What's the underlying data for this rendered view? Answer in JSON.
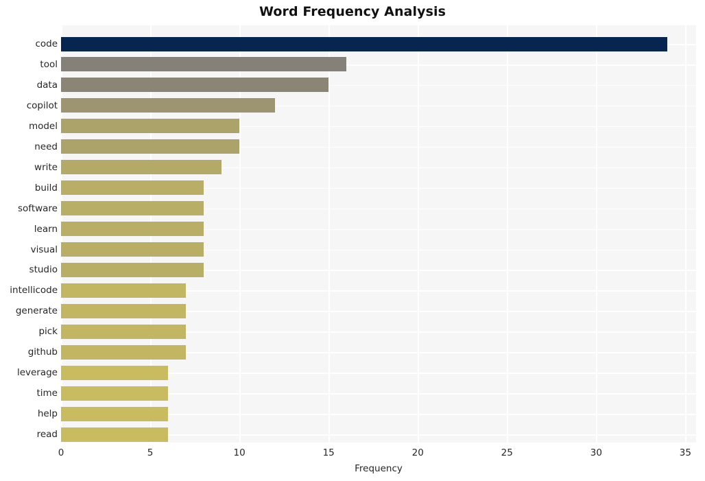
{
  "chart_data": {
    "type": "bar",
    "orientation": "horizontal",
    "title": "Word Frequency Analysis",
    "xlabel": "Frequency",
    "ylabel": "",
    "categories": [
      "code",
      "tool",
      "data",
      "copilot",
      "model",
      "need",
      "write",
      "build",
      "software",
      "learn",
      "visual",
      "studio",
      "intellicode",
      "generate",
      "pick",
      "github",
      "leverage",
      "time",
      "help",
      "read"
    ],
    "values": [
      34,
      16,
      15,
      12,
      10,
      10,
      9,
      8,
      8,
      8,
      8,
      8,
      7,
      7,
      7,
      7,
      6,
      6,
      6,
      6
    ],
    "xlim": [
      0,
      35.6
    ],
    "xticks": [
      0,
      5,
      10,
      15,
      20,
      25,
      30,
      35
    ],
    "xticklabels": [
      "0",
      "5",
      "10",
      "15",
      "20",
      "25",
      "30",
      "35"
    ],
    "grid": true,
    "grid_color": "#ffffff",
    "plot_background": "#f6f6f7",
    "figure_background": "#ffffff",
    "legend": null,
    "bar_colors": [
      "#06254f",
      "#858078",
      "#8a8574",
      "#9d9572",
      "#aca36b",
      "#aca36b",
      "#b3a968",
      "#b9ae66",
      "#b9ae66",
      "#b9ae66",
      "#b9ae66",
      "#b9ae66",
      "#c2b663",
      "#c2b663",
      "#c2b663",
      "#c2b663",
      "#c9bc60",
      "#c9bc60",
      "#c9bc60",
      "#c9bc60"
    ]
  }
}
